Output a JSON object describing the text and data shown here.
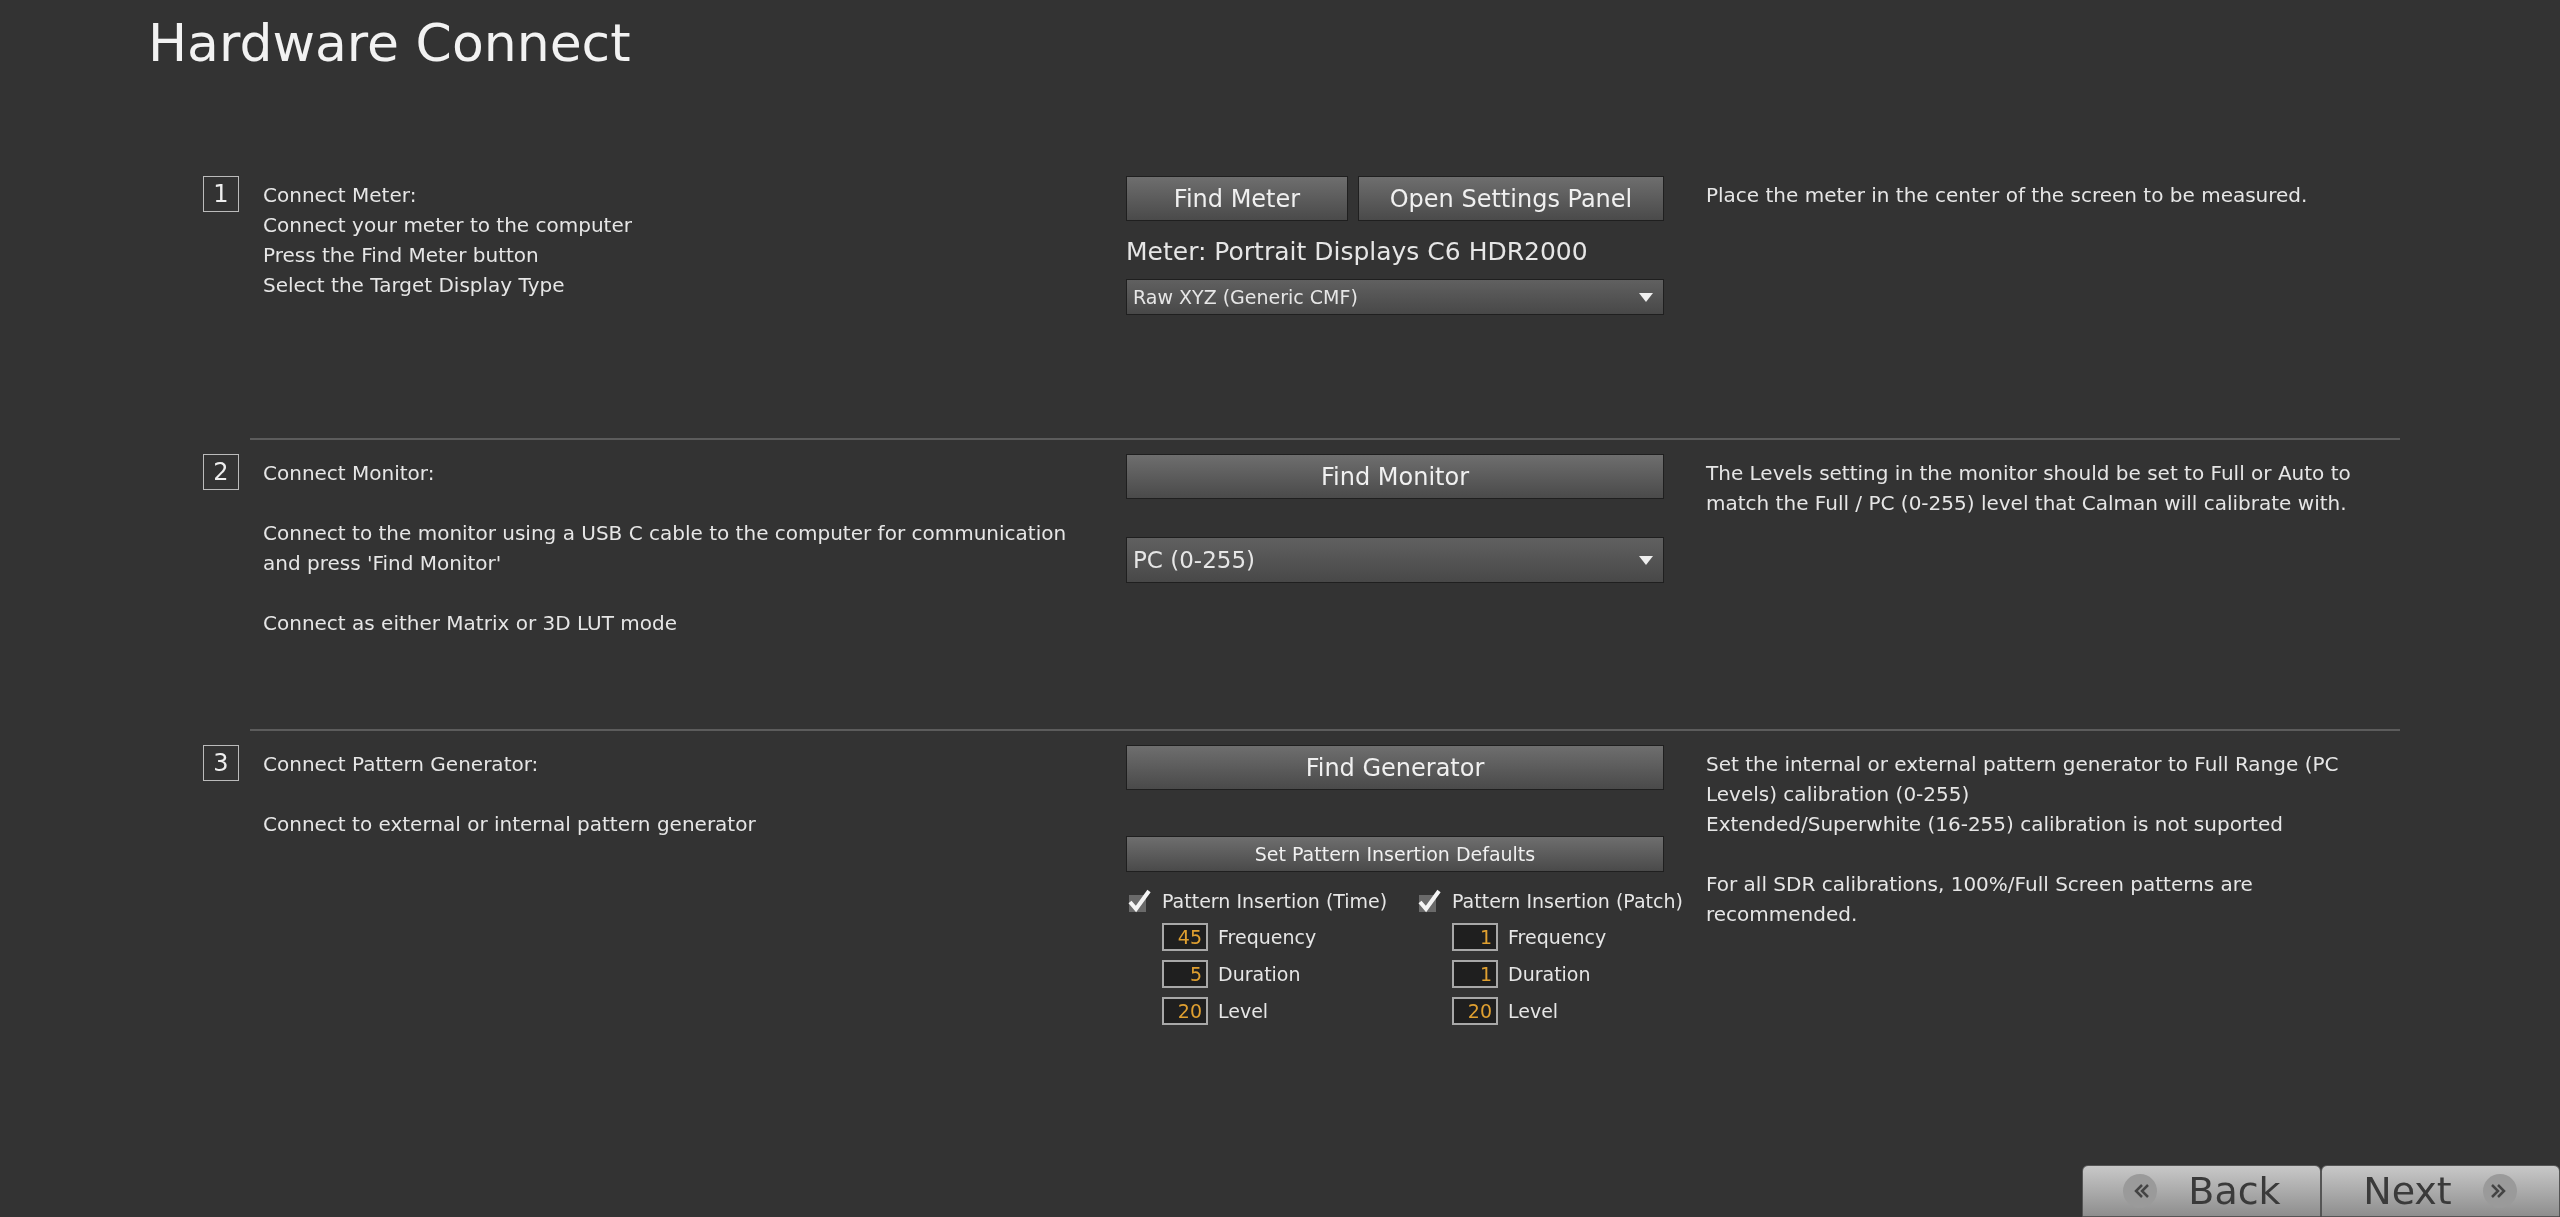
{
  "title": "Hardware Connect",
  "steps": [
    {
      "number": "1",
      "text": [
        [
          "Connect Meter:",
          "Connect your meter to the computer",
          "Press the Find Meter button",
          "Select the Target Display Type"
        ]
      ],
      "controls": [
        {
          "kind": "button_row",
          "buttons": [
            "Find Meter",
            "Open Settings Panel"
          ]
        },
        {
          "kind": "label",
          "text": "Meter: Portrait Displays C6 HDR2000"
        },
        {
          "kind": "dropdown_small",
          "value": "Raw XYZ (Generic CMF)"
        }
      ],
      "notes": [
        [
          "Place the meter in the center of the screen to be measured."
        ]
      ]
    },
    {
      "number": "2",
      "text": [
        [
          "Connect Monitor:"
        ],
        [
          "Connect to the monitor using a USB C cable to the computer for communication",
          "and press 'Find Monitor'"
        ],
        [
          "Connect as either Matrix or 3D LUT mode"
        ]
      ],
      "controls": [
        {
          "kind": "button",
          "label": "Find Monitor"
        },
        {
          "kind": "dropdown_large",
          "value": "PC (0-255)"
        }
      ],
      "notes": [
        [
          "The Levels setting in the monitor should be set to Full or Auto to",
          "match the Full / PC (0-255) level that Calman will calibrate with."
        ]
      ]
    },
    {
      "number": "3",
      "text": [
        [
          "Connect Pattern Generator:"
        ],
        [
          "Connect to external or internal pattern generator"
        ]
      ],
      "controls": [
        {
          "kind": "button",
          "label": "Find Generator"
        },
        {
          "kind": "small_button",
          "label": "Set Pattern Insertion Defaults"
        },
        {
          "kind": "insertion",
          "groups": [
            {
              "label": "Pattern Insertion (Time)",
              "checked": true,
              "fields": [
                {
                  "value": "45",
                  "label": "Frequency"
                },
                {
                  "value": "5",
                  "label": "Duration"
                },
                {
                  "value": "20",
                  "label": "Level"
                }
              ]
            },
            {
              "label": "Pattern Insertion (Patch)",
              "checked": true,
              "fields": [
                {
                  "value": "1",
                  "label": "Frequency"
                },
                {
                  "value": "1",
                  "label": "Duration"
                },
                {
                  "value": "20",
                  "label": "Level"
                }
              ]
            }
          ]
        }
      ],
      "notes": [
        [
          "Set the internal or external pattern generator to Full Range (PC",
          "Levels) calibration (0-255)",
          "Extended/Superwhite (16-255) calibration is not suported"
        ],
        [
          "For all SDR calibrations, 100%/Full Screen patterns are",
          "recommended."
        ]
      ]
    }
  ],
  "nav": [
    {
      "label": "Back",
      "kind": "back"
    },
    {
      "label": "Next",
      "kind": "next"
    }
  ]
}
